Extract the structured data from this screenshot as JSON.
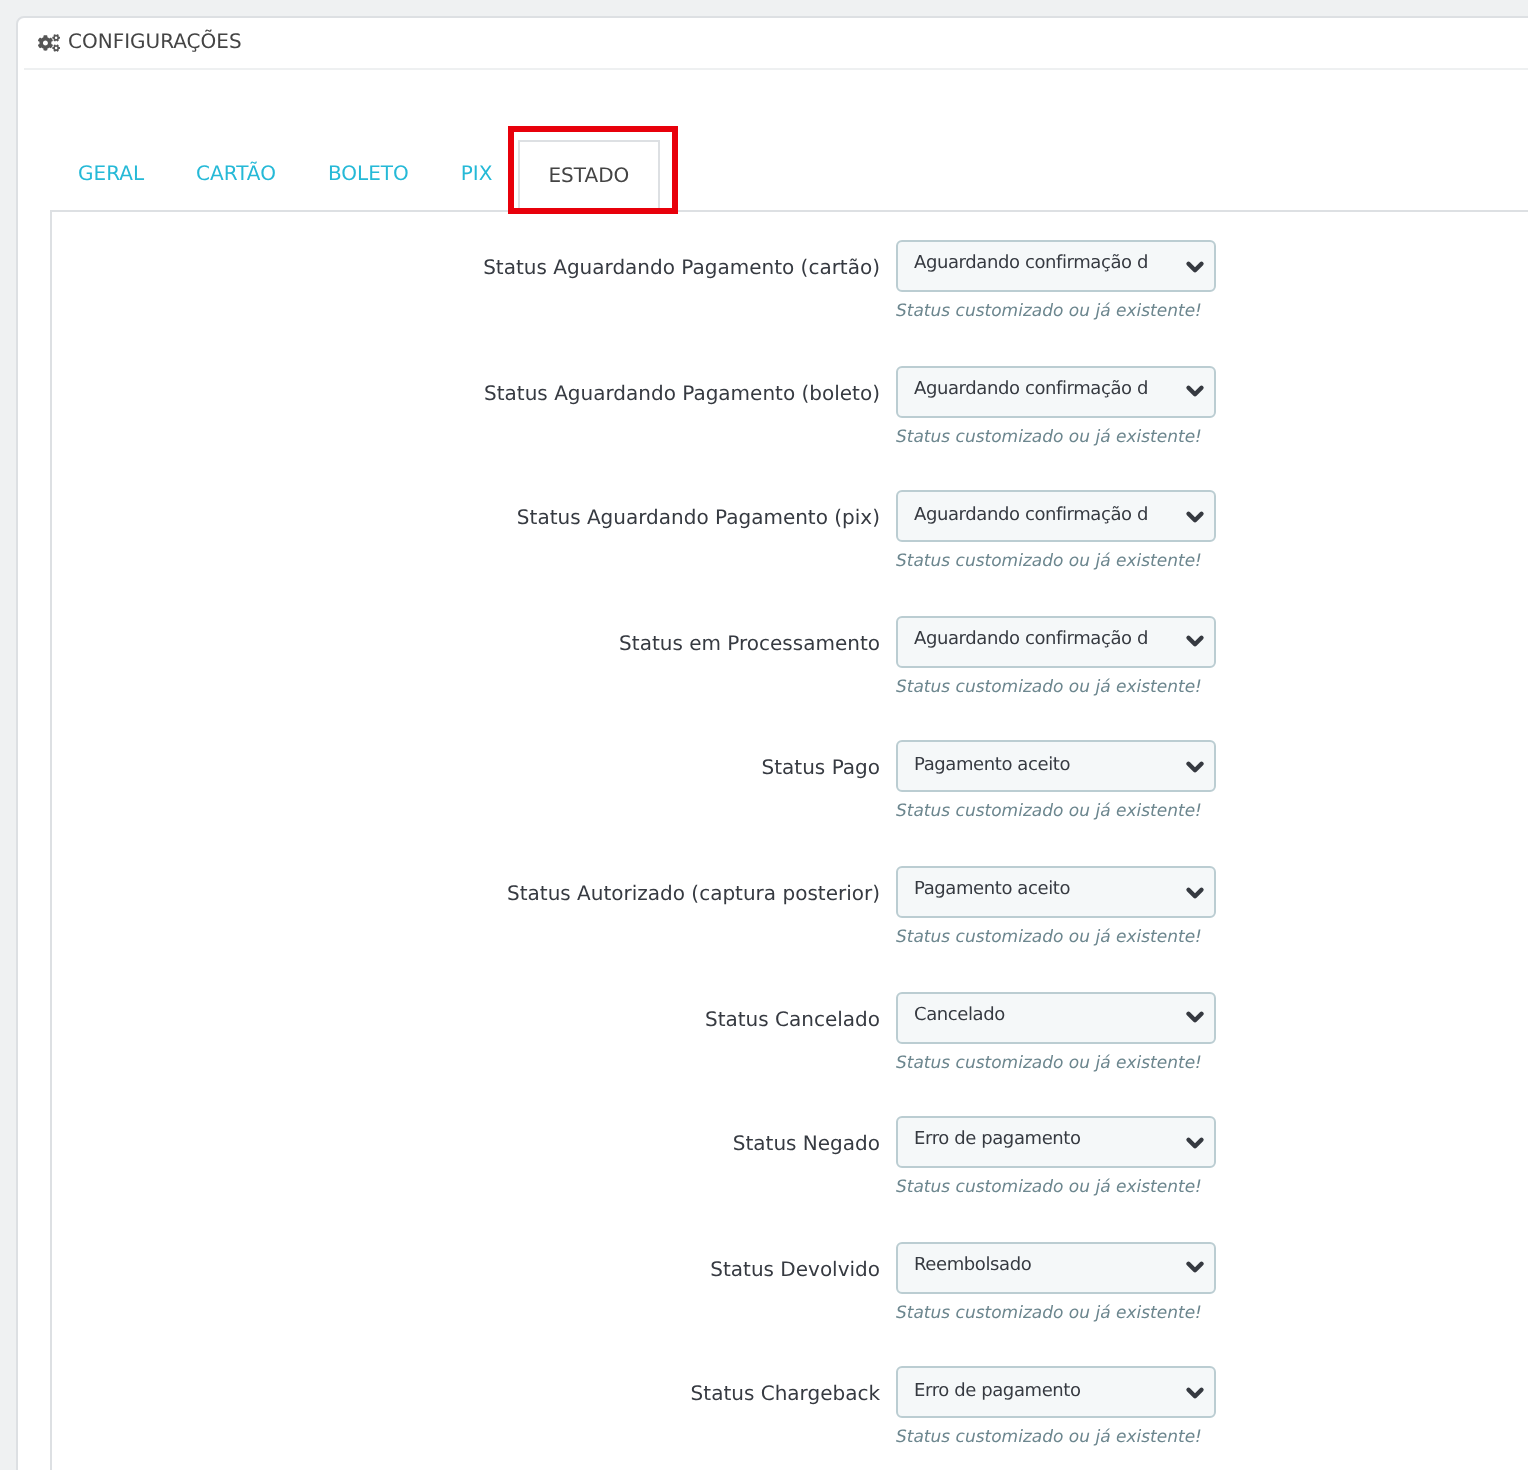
{
  "panel": {
    "title": "CONFIGURAÇÕES"
  },
  "tabs": [
    {
      "label": "GERAL",
      "selected": false
    },
    {
      "label": "CARTÃO",
      "selected": false
    },
    {
      "label": "BOLETO",
      "selected": false
    },
    {
      "label": "PIX",
      "selected": false
    },
    {
      "label": "ESTADO",
      "selected": true,
      "highlighted": true
    }
  ],
  "fields": [
    {
      "label": "Status Aguardando Pagamento (cartão)",
      "value": "Aguardando confirmação d",
      "help": "Status customizado ou já existente!"
    },
    {
      "label": "Status Aguardando Pagamento (boleto)",
      "value": "Aguardando confirmação d",
      "help": "Status customizado ou já existente!"
    },
    {
      "label": "Status Aguardando Pagamento (pix)",
      "value": "Aguardando confirmação d",
      "help": "Status customizado ou já existente!"
    },
    {
      "label": "Status em Processamento",
      "value": "Aguardando confirmação d",
      "help": "Status customizado ou já existente!"
    },
    {
      "label": "Status Pago",
      "value": "Pagamento aceito",
      "help": "Status customizado ou já existente!"
    },
    {
      "label": "Status Autorizado (captura posterior)",
      "value": "Pagamento aceito",
      "help": "Status customizado ou já existente!"
    },
    {
      "label": "Status Cancelado",
      "value": "Cancelado",
      "help": "Status customizado ou já existente!"
    },
    {
      "label": "Status Negado",
      "value": "Erro de pagamento",
      "help": "Status customizado ou já existente!"
    },
    {
      "label": "Status Devolvido",
      "value": "Reembolsado",
      "help": "Status customizado ou já existente!"
    },
    {
      "label": "Status Chargeback",
      "value": "Erro de pagamento",
      "help": "Status customizado ou já existente!"
    }
  ]
}
